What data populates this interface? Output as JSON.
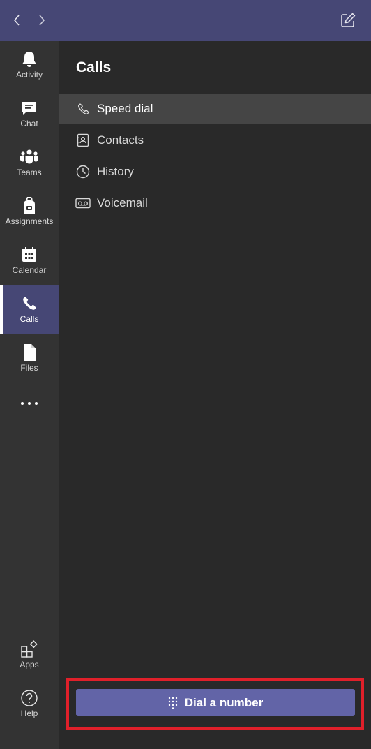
{
  "rail": {
    "items": [
      {
        "label": "Activity"
      },
      {
        "label": "Chat"
      },
      {
        "label": "Teams"
      },
      {
        "label": "Assignments"
      },
      {
        "label": "Calendar"
      },
      {
        "label": "Calls",
        "active": true
      },
      {
        "label": "Files"
      }
    ],
    "more_label": "···",
    "bottom": [
      {
        "label": "Apps"
      },
      {
        "label": "Help"
      }
    ]
  },
  "calls": {
    "title": "Calls",
    "menu": [
      {
        "label": "Speed dial",
        "icon": "phone-icon",
        "selected": true
      },
      {
        "label": "Contacts",
        "icon": "contact-card-icon"
      },
      {
        "label": "History",
        "icon": "clock-icon"
      },
      {
        "label": "Voicemail",
        "icon": "voicemail-icon"
      }
    ],
    "dial_button": "Dial a number"
  },
  "colors": {
    "topbar": "#464775",
    "rail": "#333333",
    "pane": "#292929",
    "selected_row": "#454545",
    "accent": "#6264a7",
    "highlight_box": "#e0202a"
  }
}
